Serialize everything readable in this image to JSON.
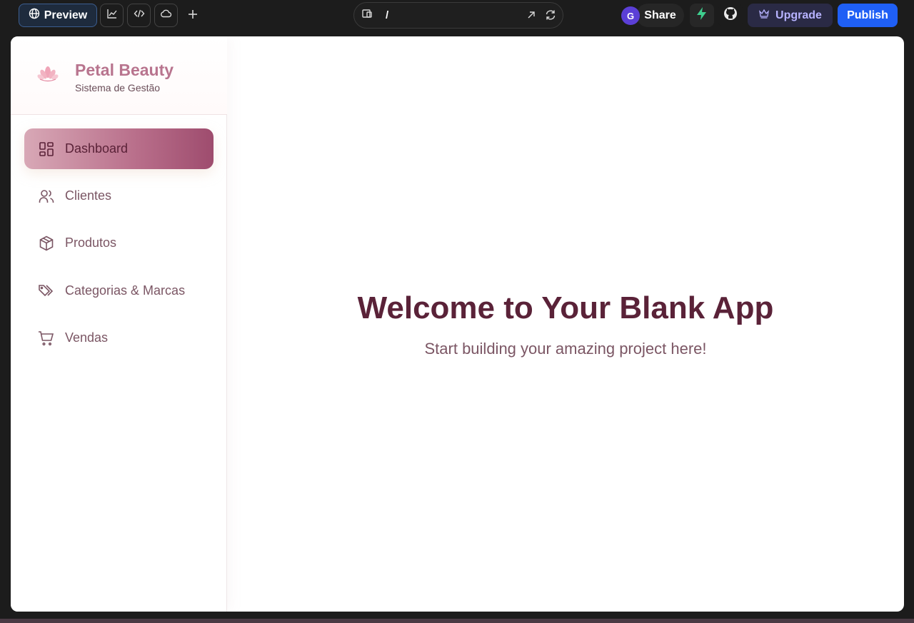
{
  "toolbar": {
    "preview_label": "Preview",
    "icons": [
      "globe-icon",
      "chart-icon",
      "code-icon",
      "cloud-icon",
      "plus-icon"
    ],
    "url_path": "/",
    "avatar_initial": "G",
    "share_label": "Share",
    "upgrade_label": "Upgrade",
    "publish_label": "Publish",
    "colors": {
      "publish": "#1f5ff5",
      "upgrade_text": "#b7b3ff",
      "bolt": "#3ecf8e"
    }
  },
  "sidebar": {
    "brand_title": "Petal Beauty",
    "brand_subtitle": "Sistema de Gestão",
    "items": [
      {
        "label": "Dashboard",
        "icon": "grid-icon",
        "active": true
      },
      {
        "label": "Clientes",
        "icon": "users-icon",
        "active": false
      },
      {
        "label": "Produtos",
        "icon": "package-icon",
        "active": false
      },
      {
        "label": "Categorias & Marcas",
        "icon": "tags-icon",
        "active": false
      },
      {
        "label": "Vendas",
        "icon": "cart-icon",
        "active": false
      }
    ],
    "colors": {
      "brand": "#b8748e",
      "active_text": "#5a2238",
      "item_text": "#7b5664"
    }
  },
  "main": {
    "heading": "Welcome to Your Blank App",
    "subheading": "Start building your amazing project here!"
  }
}
